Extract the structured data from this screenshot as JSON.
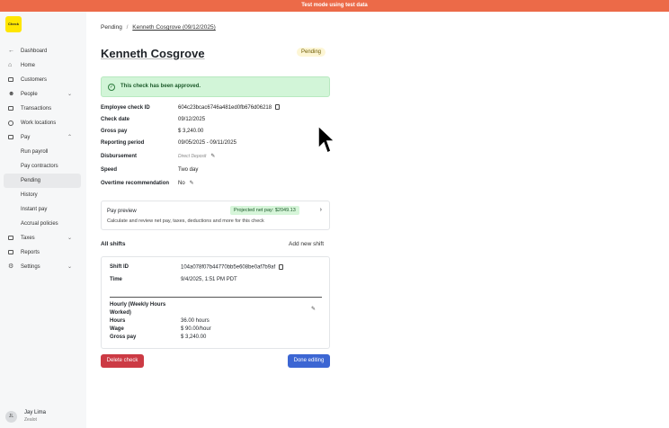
{
  "banner": "Test mode using test data",
  "logo": "Check",
  "sidebar": {
    "items": [
      {
        "label": "Dashboard",
        "icon": "arrow-left-icon"
      },
      {
        "label": "Home",
        "icon": "home-icon"
      },
      {
        "label": "Customers",
        "icon": "customers-icon"
      },
      {
        "label": "People",
        "icon": "people-icon"
      },
      {
        "label": "Transactions",
        "icon": "transactions-icon"
      },
      {
        "label": "Work locations",
        "icon": "location-icon"
      },
      {
        "label": "Pay",
        "icon": "pay-icon"
      },
      {
        "label": "Run payroll"
      },
      {
        "label": "Pay contractors"
      },
      {
        "label": "Pending"
      },
      {
        "label": "History"
      },
      {
        "label": "Instant pay"
      },
      {
        "label": "Accrual policies"
      },
      {
        "label": "Taxes",
        "icon": "taxes-icon"
      },
      {
        "label": "Reports",
        "icon": "reports-icon"
      },
      {
        "label": "Settings",
        "icon": "gear-icon"
      }
    ],
    "user": {
      "initials": "JL",
      "name": "Jay Lima",
      "org": "Zealot"
    }
  },
  "breadcrumb": {
    "parent": "Pending",
    "sep": "/",
    "current": "Kenneth Cosgrove (09/12/2025)"
  },
  "page": {
    "title": "Kenneth Cosgrove",
    "status": "Pending"
  },
  "alert": "This check has been approved.",
  "fields": [
    {
      "label": "Employee check ID",
      "value": "604c23bcac6746a481ed0fb676d06218"
    },
    {
      "label": "Check date",
      "value": "09/12/2025"
    },
    {
      "label": "Gross pay",
      "value": "$ 3,240.00"
    },
    {
      "label": "Reporting period",
      "value": "09/05/2025 - 09/11/2025"
    },
    {
      "label": "Disbursement",
      "value": "Direct Deposit"
    },
    {
      "label": "Speed",
      "value": "Two day"
    },
    {
      "label": "Overtime recommendation",
      "value": "No"
    }
  ],
  "preview": {
    "title": "Pay preview",
    "subtitle": "Calculate and review net pay, taxes, deductions and more for this check",
    "net": "Projected net pay: $2049.13"
  },
  "shifts": {
    "heading": "All shifts",
    "add": "Add new shift",
    "shift_id_label": "Shift ID",
    "shift_id": "104a078f07b44770bb5e608be0af7b9af",
    "time_label": "Time",
    "time": "9/4/2025, 1:51 PM PDT",
    "type_label": "Hourly (Weekly Hours Worked)",
    "hours_label": "Hours",
    "hours": "36.00 hours",
    "wage_label": "Wage",
    "wage": "$ 90.00/hour",
    "gross_label": "Gross pay",
    "gross": "$ 3,240.00"
  },
  "buttons": {
    "delete": "Delete check",
    "done": "Done editing"
  },
  "colors": {
    "banner": "#ec6a48",
    "danger": "#cc3a44",
    "primary": "#3c66d3",
    "success_bg": "#d2f5d8"
  }
}
